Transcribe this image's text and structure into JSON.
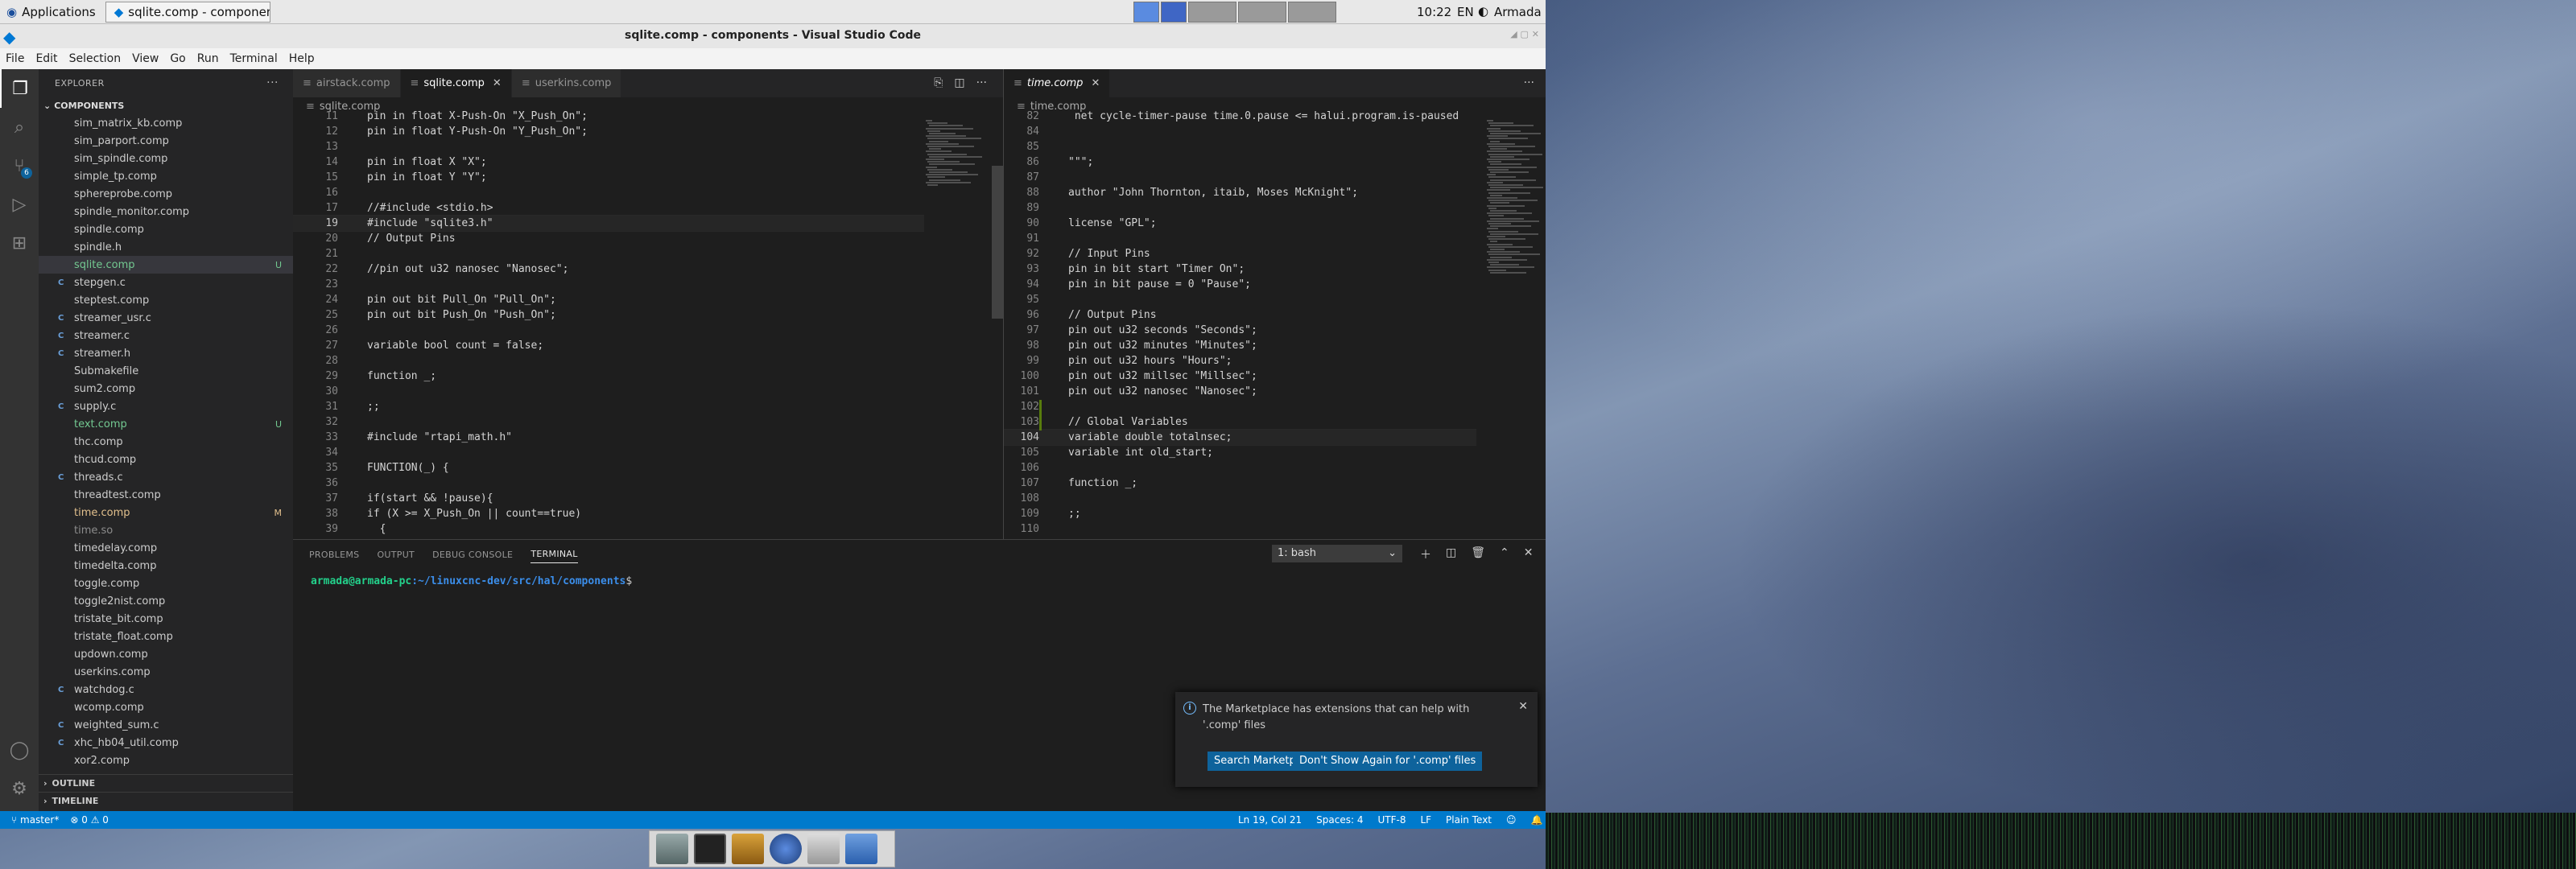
{
  "panel": {
    "apps_label": "Applications",
    "task_title": "sqlite.comp - componen...",
    "clock": "10:22",
    "lang": "EN",
    "user": "Armada"
  },
  "window": {
    "title": "sqlite.comp - components - Visual Studio Code"
  },
  "menu": [
    "File",
    "Edit",
    "Selection",
    "View",
    "Go",
    "Run",
    "Terminal",
    "Help"
  ],
  "sidebar": {
    "title": "EXPLORER",
    "section": "COMPONENTS",
    "files": [
      {
        "name": "sim_matrix_kb.comp",
        "type": "",
        "color": "#cccccc",
        "status": ""
      },
      {
        "name": "sim_parport.comp",
        "type": "",
        "color": "#cccccc",
        "status": ""
      },
      {
        "name": "sim_spindle.comp",
        "type": "",
        "color": "#cccccc",
        "status": ""
      },
      {
        "name": "simple_tp.comp",
        "type": "",
        "color": "#cccccc",
        "status": ""
      },
      {
        "name": "sphereprobe.comp",
        "type": "",
        "color": "#cccccc",
        "status": ""
      },
      {
        "name": "spindle_monitor.comp",
        "type": "",
        "color": "#cccccc",
        "status": ""
      },
      {
        "name": "spindle.comp",
        "type": "",
        "color": "#cccccc",
        "status": ""
      },
      {
        "name": "spindle.h",
        "type": "",
        "color": "#cccccc",
        "status": ""
      },
      {
        "name": "sqlite.comp",
        "type": "",
        "color": "#73c991",
        "status": "U",
        "selected": true
      },
      {
        "name": "stepgen.c",
        "type": "C",
        "color": "#cccccc",
        "status": ""
      },
      {
        "name": "steptest.comp",
        "type": "",
        "color": "#cccccc",
        "status": ""
      },
      {
        "name": "streamer_usr.c",
        "type": "C",
        "color": "#cccccc",
        "status": ""
      },
      {
        "name": "streamer.c",
        "type": "C",
        "color": "#cccccc",
        "status": ""
      },
      {
        "name": "streamer.h",
        "type": "C",
        "color": "#cccccc",
        "status": ""
      },
      {
        "name": "Submakefile",
        "type": "",
        "color": "#cccccc",
        "status": ""
      },
      {
        "name": "sum2.comp",
        "type": "",
        "color": "#cccccc",
        "status": ""
      },
      {
        "name": "supply.c",
        "type": "C",
        "color": "#cccccc",
        "status": ""
      },
      {
        "name": "text.comp",
        "type": "",
        "color": "#73c991",
        "status": "U"
      },
      {
        "name": "thc.comp",
        "type": "",
        "color": "#cccccc",
        "status": ""
      },
      {
        "name": "thcud.comp",
        "type": "",
        "color": "#cccccc",
        "status": ""
      },
      {
        "name": "threads.c",
        "type": "C",
        "color": "#cccccc",
        "status": ""
      },
      {
        "name": "threadtest.comp",
        "type": "",
        "color": "#cccccc",
        "status": ""
      },
      {
        "name": "time.comp",
        "type": "",
        "color": "#e2c08d",
        "status": "M"
      },
      {
        "name": "time.so",
        "type": "",
        "color": "#8c8c8c",
        "status": ""
      },
      {
        "name": "timedelay.comp",
        "type": "",
        "color": "#cccccc",
        "status": ""
      },
      {
        "name": "timedelta.comp",
        "type": "",
        "color": "#cccccc",
        "status": ""
      },
      {
        "name": "toggle.comp",
        "type": "",
        "color": "#cccccc",
        "status": ""
      },
      {
        "name": "toggle2nist.comp",
        "type": "",
        "color": "#cccccc",
        "status": ""
      },
      {
        "name": "tristate_bit.comp",
        "type": "",
        "color": "#cccccc",
        "status": ""
      },
      {
        "name": "tristate_float.comp",
        "type": "",
        "color": "#cccccc",
        "status": ""
      },
      {
        "name": "updown.comp",
        "type": "",
        "color": "#cccccc",
        "status": ""
      },
      {
        "name": "userkins.comp",
        "type": "",
        "color": "#cccccc",
        "status": ""
      },
      {
        "name": "watchdog.c",
        "type": "C",
        "color": "#cccccc",
        "status": ""
      },
      {
        "name": "wcomp.comp",
        "type": "",
        "color": "#cccccc",
        "status": ""
      },
      {
        "name": "weighted_sum.c",
        "type": "C",
        "color": "#cccccc",
        "status": ""
      },
      {
        "name": "xhc_hb04_util.comp",
        "type": "C",
        "color": "#cccccc",
        "status": ""
      },
      {
        "name": "xor2.comp",
        "type": "",
        "color": "#cccccc",
        "status": ""
      }
    ],
    "outline": "OUTLINE",
    "timeline": "TIMELINE"
  },
  "editor_left": {
    "tabs": [
      {
        "label": "airstack.comp",
        "active": false
      },
      {
        "label": "sqlite.comp",
        "active": true
      },
      {
        "label": "userkins.comp",
        "active": false
      }
    ],
    "breadcrumb": "sqlite.comp",
    "lines": [
      {
        "n": "11",
        "t": "pin in float X-Push-On \"X_Push_On\";"
      },
      {
        "n": "12",
        "t": "pin in float Y-Push-On \"Y_Push_On\";"
      },
      {
        "n": "13",
        "t": ""
      },
      {
        "n": "14",
        "t": "pin in float X \"X\";"
      },
      {
        "n": "15",
        "t": "pin in float Y \"Y\";"
      },
      {
        "n": "16",
        "t": ""
      },
      {
        "n": "17",
        "t": "//#include <stdio.h>"
      },
      {
        "n": "19",
        "t": "#include \"sqlite3.h\""
      },
      {
        "n": "20",
        "t": "// Output Pins"
      },
      {
        "n": "21",
        "t": ""
      },
      {
        "n": "22",
        "t": "//pin out u32 nanosec \"Nanosec\";"
      },
      {
        "n": "23",
        "t": ""
      },
      {
        "n": "24",
        "t": "pin out bit Pull_On \"Pull_On\";"
      },
      {
        "n": "25",
        "t": "pin out bit Push_On \"Push_On\";"
      },
      {
        "n": "26",
        "t": ""
      },
      {
        "n": "27",
        "t": "variable bool count = false;"
      },
      {
        "n": "28",
        "t": ""
      },
      {
        "n": "29",
        "t": "function _;"
      },
      {
        "n": "30",
        "t": ""
      },
      {
        "n": "31",
        "t": ";;"
      },
      {
        "n": "32",
        "t": ""
      },
      {
        "n": "33",
        "t": "#include \"rtapi_math.h\""
      },
      {
        "n": "34",
        "t": ""
      },
      {
        "n": "35",
        "t": "FUNCTION(_) {"
      },
      {
        "n": "36",
        "t": ""
      },
      {
        "n": "37",
        "t": "if(start && !pause){"
      },
      {
        "n": "38",
        "t": "if (X >= X_Push_On || count==true)"
      },
      {
        "n": "39",
        "t": "  {"
      }
    ]
  },
  "editor_right": {
    "tabs": [
      {
        "label": "time.comp",
        "active": true
      }
    ],
    "breadcrumb": "time.comp",
    "lines": [
      {
        "n": "82",
        "t": " net cycle-timer-pause time.0.pause <= halui.program.is-paused"
      },
      {
        "n": "84",
        "t": ""
      },
      {
        "n": "85",
        "t": ""
      },
      {
        "n": "86",
        "t": "\"\"\";"
      },
      {
        "n": "87",
        "t": ""
      },
      {
        "n": "88",
        "t": "author \"John Thornton, itaib, Moses McKnight\";"
      },
      {
        "n": "89",
        "t": ""
      },
      {
        "n": "90",
        "t": "license \"GPL\";"
      },
      {
        "n": "91",
        "t": ""
      },
      {
        "n": "92",
        "t": "// Input Pins"
      },
      {
        "n": "93",
        "t": "pin in bit start \"Timer On\";"
      },
      {
        "n": "94",
        "t": "pin in bit pause = 0 \"Pause\";"
      },
      {
        "n": "95",
        "t": ""
      },
      {
        "n": "96",
        "t": "// Output Pins"
      },
      {
        "n": "97",
        "t": "pin out u32 seconds \"Seconds\";"
      },
      {
        "n": "98",
        "t": "pin out u32 minutes \"Minutes\";"
      },
      {
        "n": "99",
        "t": "pin out u32 hours \"Hours\";"
      },
      {
        "n": "100",
        "t": "pin out u32 millsec \"Millsec\";"
      },
      {
        "n": "101",
        "t": "pin out u32 nanosec \"Nanosec\";"
      },
      {
        "n": "102",
        "t": ""
      },
      {
        "n": "103",
        "t": "// Global Variables"
      },
      {
        "n": "104",
        "t": "variable double totalnsec;"
      },
      {
        "n": "105",
        "t": "variable int old_start;"
      },
      {
        "n": "106",
        "t": ""
      },
      {
        "n": "107",
        "t": "function _;"
      },
      {
        "n": "108",
        "t": ""
      },
      {
        "n": "109",
        "t": ";;"
      },
      {
        "n": "110",
        "t": ""
      }
    ]
  },
  "terminal": {
    "tabs": [
      "PROBLEMS",
      "OUTPUT",
      "DEBUG CONSOLE",
      "TERMINAL"
    ],
    "shell": "1: bash",
    "prompt_user": "armada@armada-pc",
    "prompt_path": ":~/linuxcnc-dev/src/hal/components",
    "prompt_end": "$"
  },
  "notification": {
    "message": "The Marketplace has extensions that can help with '.comp' files",
    "btn_search": "Search Marketplace",
    "btn_dont_show": "Don't Show Again for '.comp' files"
  },
  "statusbar": {
    "branch": "master*",
    "problems": "0",
    "warnings": "0",
    "position": "Ln 19, Col 21",
    "spaces": "Spaces: 4",
    "encoding": "UTF-8",
    "eol": "LF",
    "language": "Plain Text"
  },
  "colors": {
    "accent": "#007acc",
    "button": "#0e639c",
    "untracked": "#73c991",
    "modified": "#e2c08d"
  }
}
